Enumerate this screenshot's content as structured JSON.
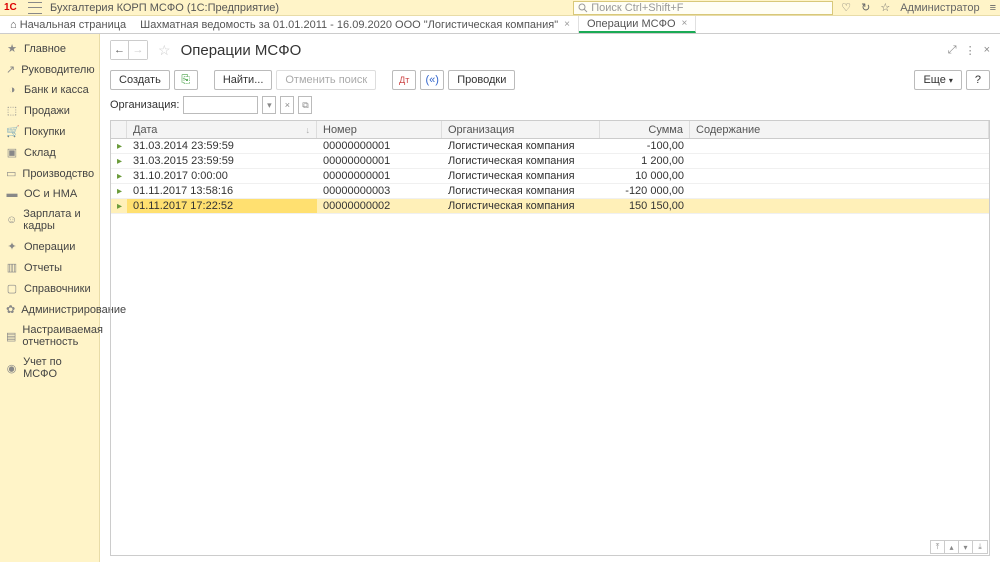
{
  "app": {
    "title": "Бухгалтерия КОРП МСФО  (1С:Предприятие)",
    "search_placeholder": "Поиск Ctrl+Shift+F",
    "user": "Администратор"
  },
  "tabs": {
    "home": "Начальная страница",
    "items": [
      {
        "label": "Шахматная ведомость за 01.01.2011 - 16.09.2020 ООО \"Логистическая компания\"",
        "active": false
      },
      {
        "label": "Операции МСФО",
        "active": true
      }
    ]
  },
  "sidebar": [
    "Главное",
    "Руководителю",
    "Банк и касса",
    "Продажи",
    "Покупки",
    "Склад",
    "Производство",
    "ОС и НМА",
    "Зарплата и кадры",
    "Операции",
    "Отчеты",
    "Справочники",
    "Администрирование",
    "Настраиваемая отчетность",
    "Учет по МСФО"
  ],
  "page": {
    "title": "Операции МСФО"
  },
  "toolbar": {
    "create": "Создать",
    "find": "Найти...",
    "cancel_search": "Отменить поиск",
    "postings": "Проводки",
    "more": "Еще",
    "help": "?"
  },
  "filter": {
    "org_label": "Организация:"
  },
  "grid": {
    "headers": {
      "date": "Дата",
      "number": "Номер",
      "org": "Организация",
      "sum": "Сумма",
      "desc": "Содержание"
    },
    "rows": [
      {
        "date": "31.03.2014 23:59:59",
        "number": "00000000001",
        "org": "Логистическая компания",
        "sum": "-100,00",
        "neg": true
      },
      {
        "date": "31.03.2015 23:59:59",
        "number": "00000000001",
        "org": "Логистическая компания",
        "sum": "1 200,00",
        "neg": false
      },
      {
        "date": "31.10.2017 0:00:00",
        "number": "00000000001",
        "org": "Логистическая компания",
        "sum": "10 000,00",
        "neg": false
      },
      {
        "date": "01.11.2017 13:58:16",
        "number": "00000000003",
        "org": "Логистическая компания",
        "sum": "-120 000,00",
        "neg": true
      },
      {
        "date": "01.11.2017 17:22:52",
        "number": "00000000002",
        "org": "Логистическая компания",
        "sum": "150 150,00",
        "neg": false,
        "selected": true
      }
    ]
  }
}
